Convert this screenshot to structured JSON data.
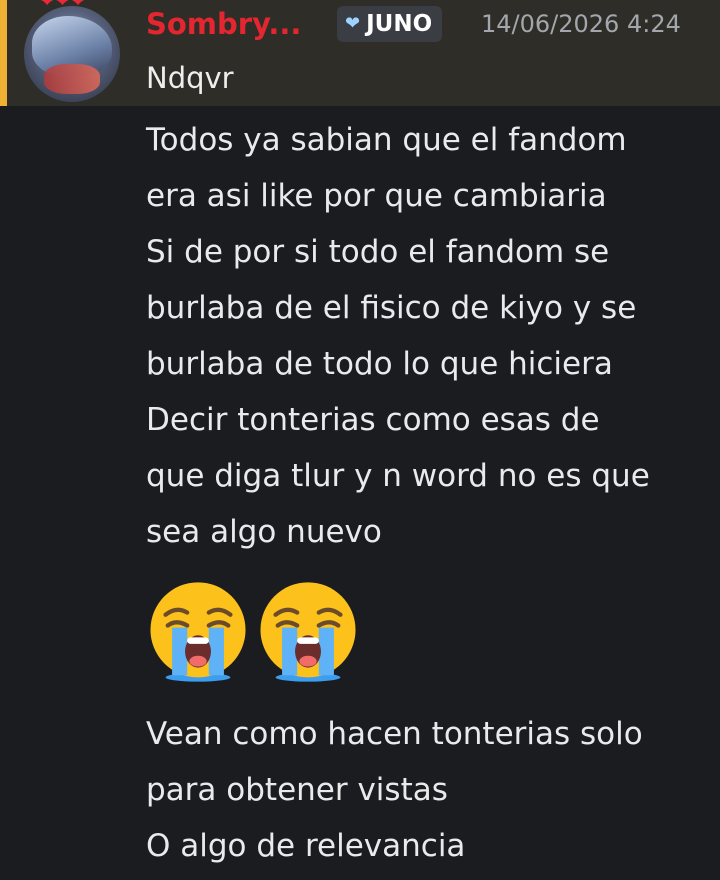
{
  "header": {
    "hearts": "❤❤❤",
    "username": "Sombry...",
    "tag": {
      "icon": "heart-icon",
      "label": "JUNO"
    },
    "timestamp": "14/06/2026 4:24",
    "reply_text": "Ndqvr"
  },
  "message": {
    "paragraph_1": [
      "Todos ya sabian que el fandom",
      "era asi like por que cambiaria"
    ],
    "paragraph_2": [
      "Si de por si todo el fandom se",
      "burlaba de el fisico de kiyo y se",
      "burlaba de todo lo que hiciera"
    ],
    "paragraph_3": [
      "Decir tonterias como esas de",
      "que diga tlur y n word no es que",
      "sea algo nuevo"
    ],
    "emojis": [
      "loudly-crying-face-emoji",
      "loudly-crying-face-emoji"
    ],
    "paragraph_4": [
      "Vean como hacen tonterias solo",
      "para obtener vistas"
    ],
    "paragraph_5": [
      "O algo de relevancia"
    ]
  },
  "colors": {
    "background": "#1b1c20",
    "header_background": "#2e2d27",
    "mention_bar": "#f0b232",
    "username": "#e3262f",
    "timestamp": "#a3a6ad"
  }
}
